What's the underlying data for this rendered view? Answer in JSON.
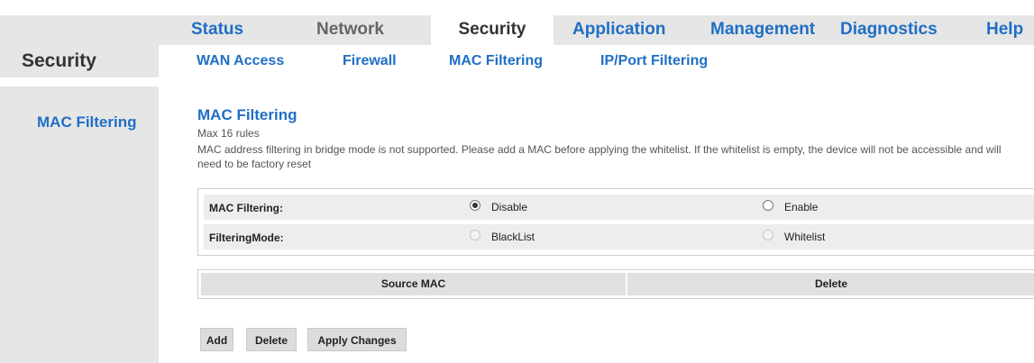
{
  "header": {
    "brand_title": "Security",
    "tabs": [
      {
        "label": "Status"
      },
      {
        "label": "Network"
      },
      {
        "label": "Security"
      },
      {
        "label": "Application"
      },
      {
        "label": "Management"
      },
      {
        "label": "Diagnostics"
      },
      {
        "label": "Help"
      }
    ],
    "subtabs": [
      {
        "label": "WAN Access"
      },
      {
        "label": "Firewall"
      },
      {
        "label": "MAC Filtering"
      },
      {
        "label": "IP/Port Filtering"
      }
    ]
  },
  "sidebar": {
    "items": [
      {
        "label": "MAC Filtering"
      }
    ]
  },
  "main": {
    "title": "MAC Filtering",
    "subtitle": "Max 16 rules",
    "description": "MAC address filtering in bridge mode is not supported. Please add a MAC before applying the whitelist. If the whitelist is empty, the device will not be accessible and will need to be factory reset",
    "options": [
      {
        "label": "MAC Filtering:",
        "choices": [
          {
            "label": "Disable",
            "checked": true
          },
          {
            "label": "Enable",
            "checked": false
          }
        ]
      },
      {
        "label": "FilteringMode:",
        "choices": [
          {
            "label": "BlackList",
            "disabled": true
          },
          {
            "label": "Whitelist",
            "disabled": true
          }
        ]
      }
    ],
    "table_headers": [
      "Source MAC",
      "Delete"
    ],
    "buttons": {
      "add": "Add",
      "delete": "Delete",
      "apply": "Apply Changes"
    }
  },
  "colors": {
    "link_blue": "#1f6fc5",
    "panel_gray": "#e6e6e6",
    "row_gray": "#ededed"
  }
}
